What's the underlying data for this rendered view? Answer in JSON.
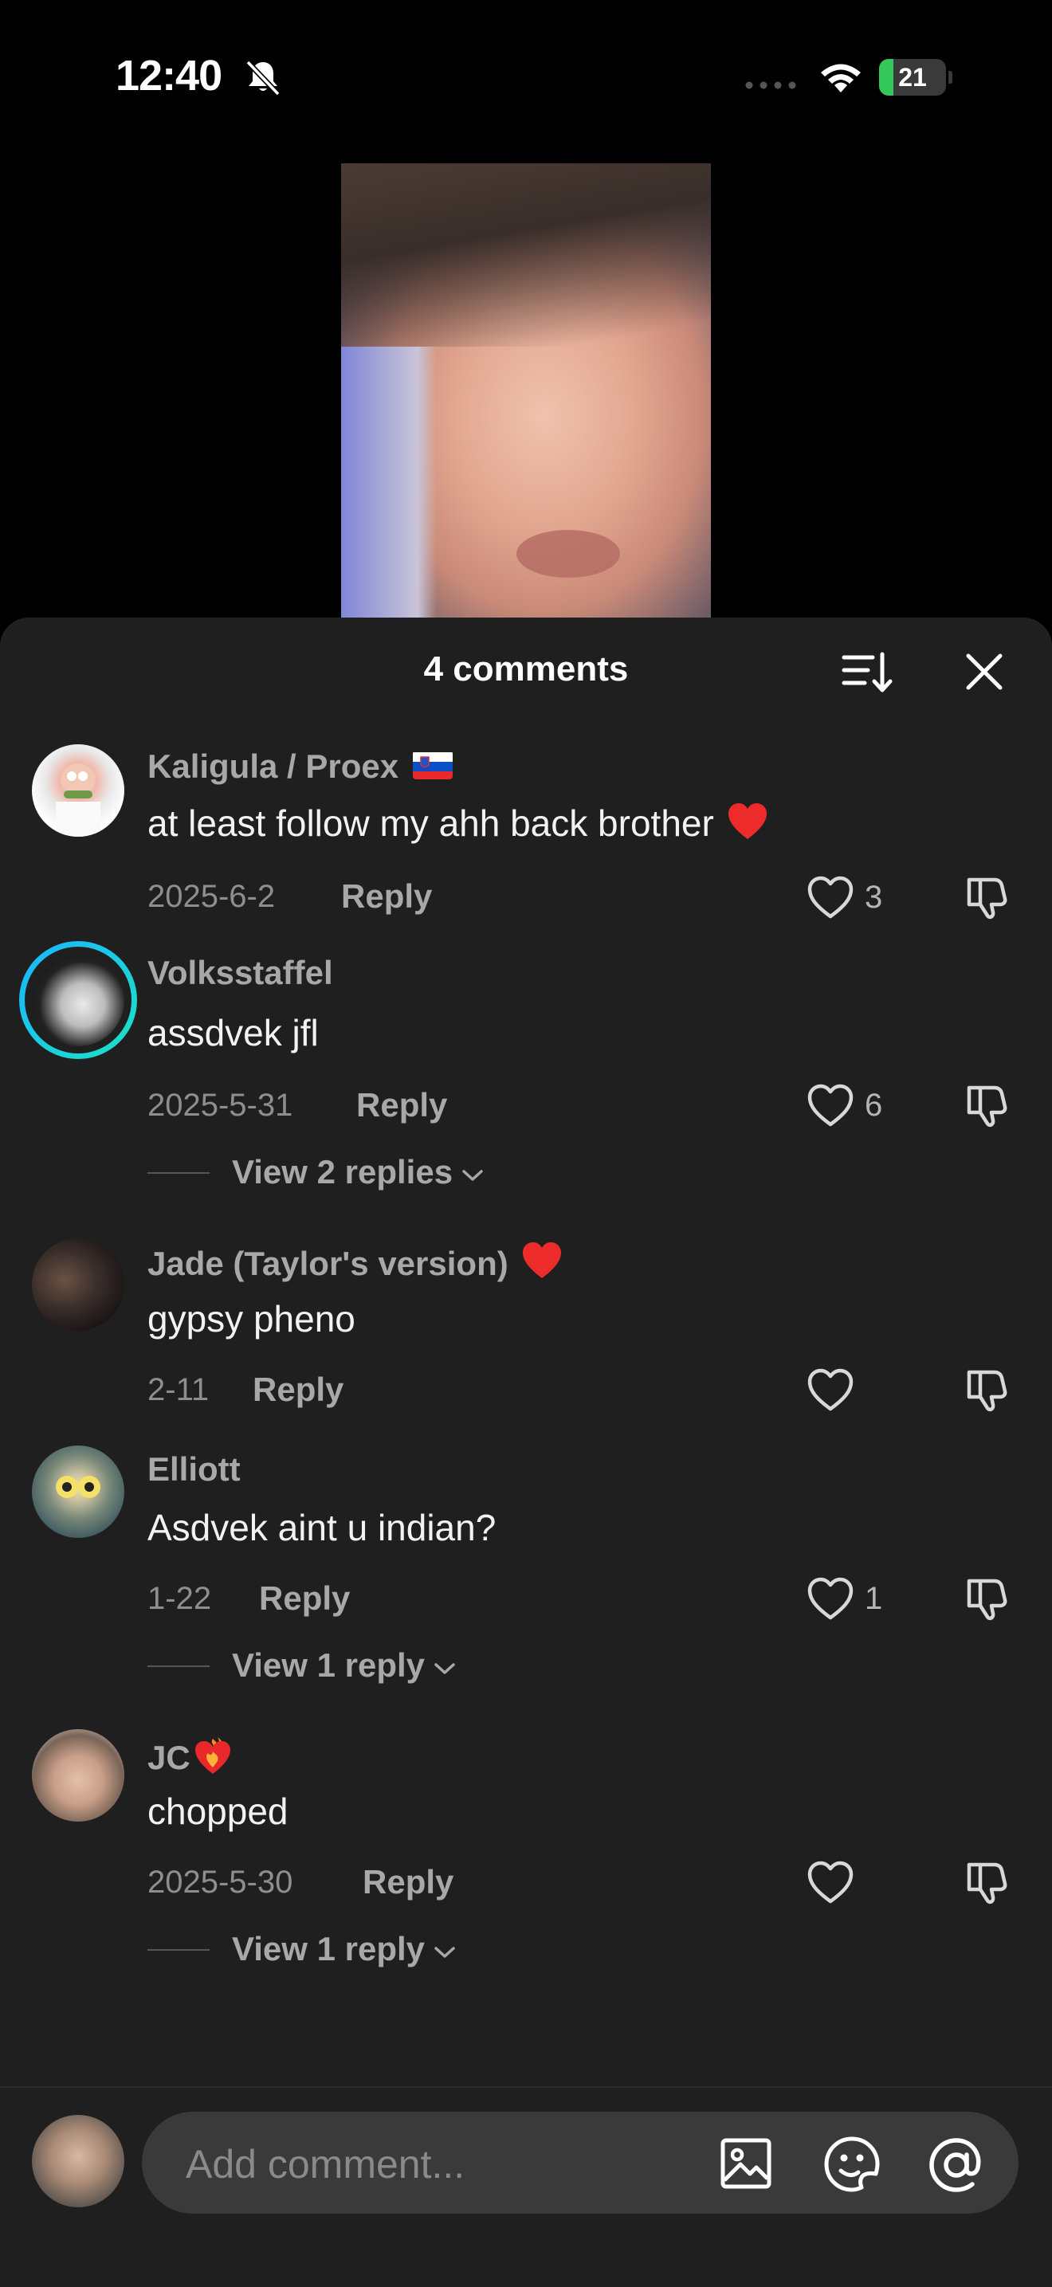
{
  "status_bar": {
    "time": "12:40",
    "battery": "21",
    "battery_level": 0.21
  },
  "sheet": {
    "title": "4 comments"
  },
  "comments": [
    {
      "name": "Kaligula / Proex",
      "text": "at least follow my ahh back brother",
      "date": "2025-6-2",
      "reply": "Reply",
      "likes": "3"
    },
    {
      "name": "Volksstaffel",
      "text": "assdvek jfl",
      "date": "2025-5-31",
      "reply": "Reply",
      "likes": "6",
      "view_replies": "View 2 replies"
    },
    {
      "name": "Jade (Taylor's version)",
      "text": "gypsy pheno",
      "date": "2-11",
      "reply": "Reply",
      "likes": ""
    },
    {
      "name": "Elliott",
      "text": "Asdvek aint u indian?",
      "date": "1-22",
      "reply": "Reply",
      "likes": "1",
      "view_replies": "View 1 reply"
    },
    {
      "name": "JC",
      "text": "chopped",
      "date": "2025-5-30",
      "reply": "Reply",
      "likes": "",
      "view_replies": "View 1 reply"
    }
  ],
  "input": {
    "placeholder": "Add comment..."
  }
}
